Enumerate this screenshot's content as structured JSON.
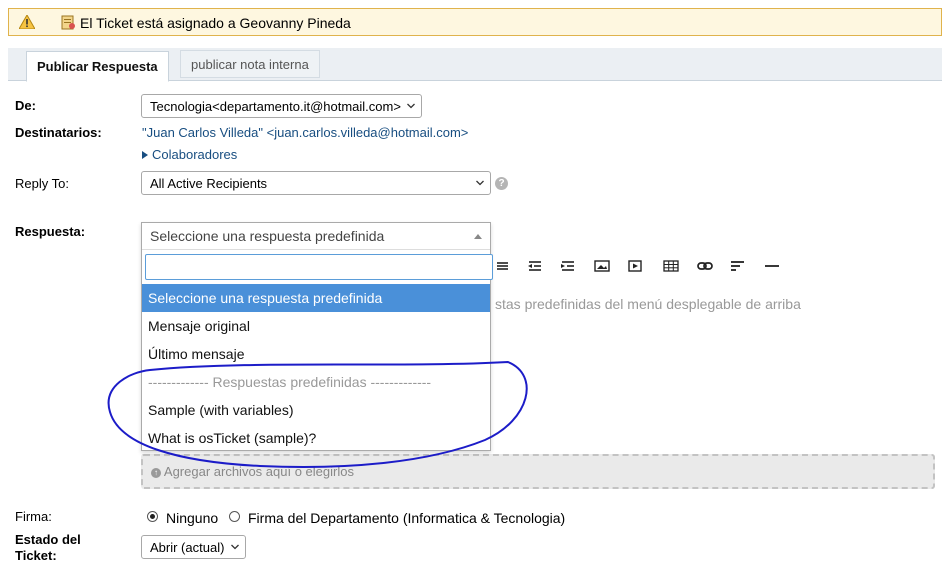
{
  "notice": {
    "text": "El Ticket está asignado a Geovanny Pineda"
  },
  "tabs": [
    {
      "label": "Publicar Respuesta",
      "active": true
    },
    {
      "label": "publicar nota interna",
      "active": false
    }
  ],
  "form": {
    "de": {
      "label": "De:",
      "value": "Tecnologia<departamento.it@hotmail.com>"
    },
    "destinatarios": {
      "label": "Destinatarios:",
      "value": "\"Juan Carlos Villeda\" <juan.carlos.villeda@hotmail.com>"
    },
    "colaboradores": "Colaboradores",
    "reply_to": {
      "label": "Reply To:",
      "value": "All Active Recipients"
    },
    "respuesta": {
      "label": "Respuesta:",
      "selected": "Seleccione una respuesta predefinida"
    },
    "editor_placeholder": "stas predefinidas del menú desplegable de arriba",
    "dropzone": "Agregar archivos aquí o elegirlos",
    "firma": {
      "label": "Firma:",
      "options": [
        "Ninguno",
        "Firma del Departamento (Informatica & Tecnologia)"
      ],
      "selected": "Ninguno"
    },
    "estado": {
      "label_line1": "Estado del",
      "label_line2": "Ticket:",
      "value": "Abrir (actual)"
    }
  },
  "dropdown": {
    "search_value": "",
    "items": [
      {
        "label": "Seleccione una respuesta predefinida",
        "highlighted": true
      },
      {
        "label": "Mensaje original"
      },
      {
        "label": "Último mensaje"
      }
    ],
    "group_label": "------------- Respuestas predefinidas -------------",
    "group_items": [
      {
        "label": "Sample (with variables)"
      },
      {
        "label": "What is osTicket (sample)?"
      }
    ]
  },
  "colors": {
    "accent": "#4a90d9",
    "link": "#184e81",
    "annotation": "#1c1cc8",
    "notice_bg": "#fef7e0"
  },
  "icons": {
    "notice": [
      "warning-icon",
      "ticket-icon"
    ],
    "toolbar": [
      "align-justify-icon",
      "outdent-icon",
      "indent-icon",
      "image-icon",
      "video-icon",
      "table-icon",
      "link-icon",
      "align-left-icon",
      "horizontal-rule-icon"
    ]
  }
}
